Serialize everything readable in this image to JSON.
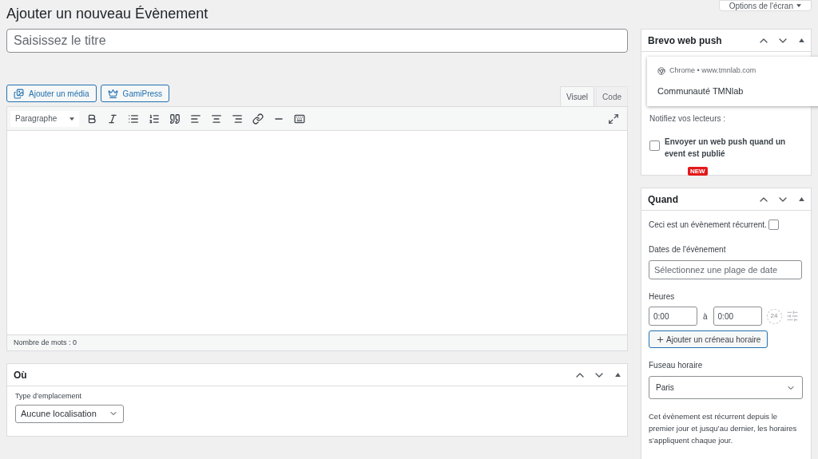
{
  "page_title": "Ajouter un nouveau Évènement",
  "screen_options": {
    "label": "Options de l'écran"
  },
  "title_field": {
    "placeholder": "Saisissez le titre"
  },
  "media_buttons": [
    {
      "label": "Ajouter un média",
      "kind": "media"
    },
    {
      "label": "GamiPress",
      "kind": "gamipress"
    }
  ],
  "editor_tabs": [
    {
      "label": "Visuel",
      "selected": true
    },
    {
      "label": "Code",
      "selected": false
    }
  ],
  "format_select": {
    "value": "Paragraphe"
  },
  "toolbar": [
    {
      "kind": "bold"
    },
    {
      "kind": "italic"
    },
    {
      "kind": "bullets"
    },
    {
      "kind": "numbers"
    },
    {
      "kind": "quote"
    },
    {
      "kind": "align-left"
    },
    {
      "kind": "align-center"
    },
    {
      "kind": "align-right"
    },
    {
      "kind": "link"
    },
    {
      "kind": "more"
    },
    {
      "kind": "toolbar"
    }
  ],
  "word_count": "Nombre de mots : 0",
  "location_box": {
    "title": "Où",
    "field_label": "Type d’emplacement",
    "select_value": "Aucune localisation"
  },
  "brevo_box": {
    "title": "Brevo web push",
    "notification": {
      "source": "Chrome • www.tmnlab.com",
      "title": "Communauté TMNlab"
    },
    "prompt": "Notifiez vos lecteurs :",
    "checkbox": {
      "label": "Envoyer un web push quand un event est publié",
      "checked": false
    },
    "badge": "NEW"
  },
  "when_box": {
    "title": "Quand",
    "recurring": {
      "label": "Ceci est un évènement récurrent.",
      "checked": false
    },
    "dates_label": "Dates de l'évènement",
    "dates_field": {
      "placeholder": "Sélectionnez une plage de date"
    },
    "hours_label": "Heures",
    "start_time": "0:00",
    "separator": "à",
    "end_time": "0:00",
    "clock_badge": "24",
    "add_slot": "Ajouter un créneau horaire",
    "timezone_label": "Fuseau horaire",
    "timezone": "Paris",
    "note": "Cet évènement est récurrent depuis le premier jour et jusqu’au dernier, les horaires s’appliquent chaque jour."
  }
}
